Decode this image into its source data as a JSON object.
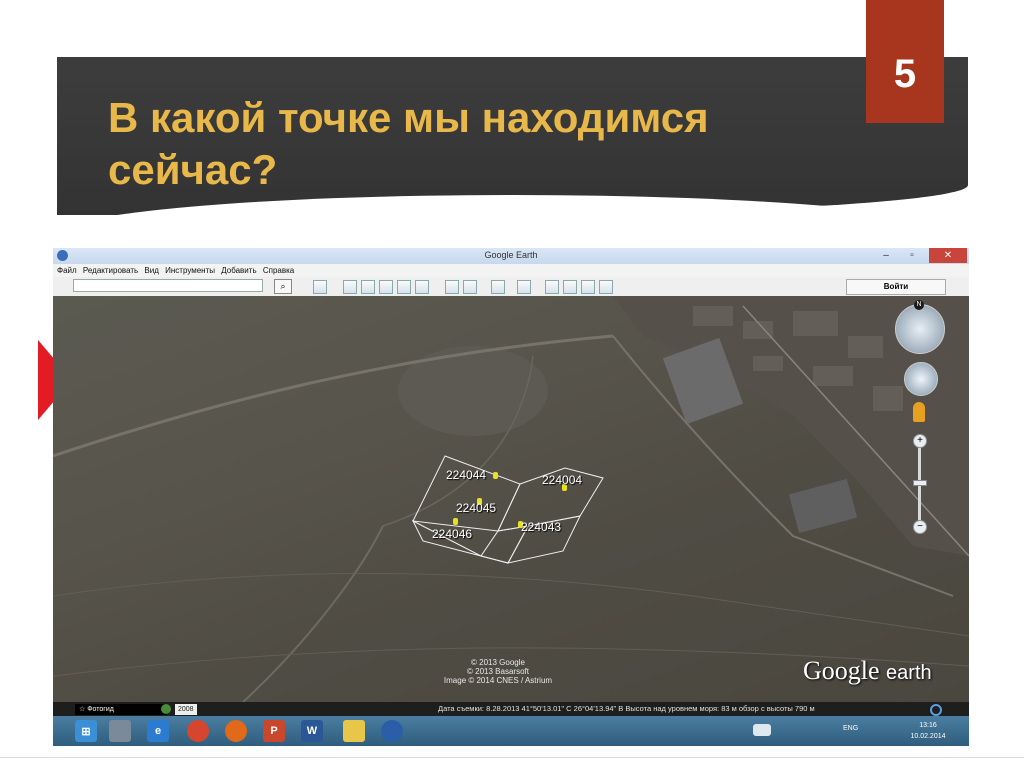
{
  "slide": {
    "title": "В какой точке мы находимся сейчас?",
    "number": "5",
    "accent_color": "#e8b84a",
    "number_bg": "#a8361e"
  },
  "window": {
    "title": "Google Earth",
    "menu": [
      "Файл",
      "Редактировать",
      "Вид",
      "Инструменты",
      "Добавить",
      "Справка"
    ],
    "search_value": "",
    "signin_label": "Войти"
  },
  "map": {
    "plots": [
      {
        "label": "224044"
      },
      {
        "label": "224004"
      },
      {
        "label": "224045"
      },
      {
        "label": "224043"
      },
      {
        "label": "224046"
      }
    ],
    "north": "N",
    "zoom_in": "+",
    "zoom_out": "−",
    "credits": [
      "© 2013 Google",
      "© 2013 Basarsoft",
      "Image © 2014 CNES / Astrium"
    ],
    "logo_google": "Google",
    "logo_earth": "earth"
  },
  "statusbar": {
    "tour_label": "☆ Фотогид",
    "year": "2008",
    "info": "Дата съемки: 8.28.2013    41°50'13.01\" С   26°04'13.94\" В  Высота над уровнем моря:   83 м    обзор с высоты   790 м"
  },
  "taskbar": {
    "tray": "ENG",
    "time": "13:16",
    "date": "10.02.2014"
  }
}
